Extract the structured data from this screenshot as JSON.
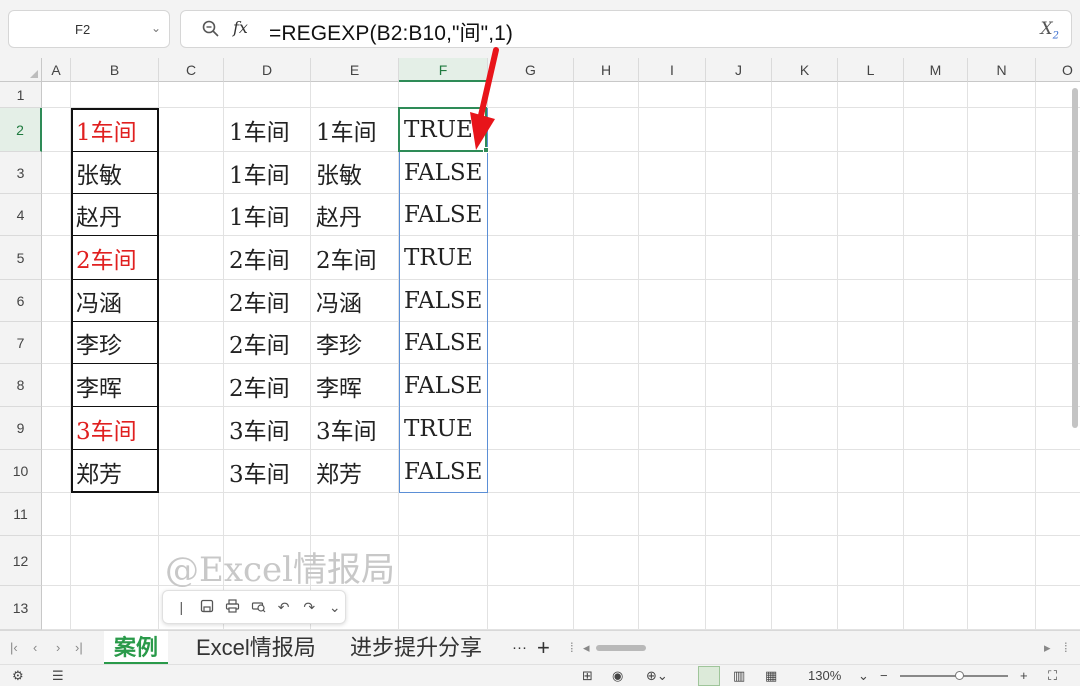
{
  "formula_bar": {
    "cell_ref": "F2",
    "formula": "=REGEXP(B2:B10,\"间\",1)",
    "fx_label": "fx",
    "clear_label": "X"
  },
  "columns": [
    "A",
    "B",
    "C",
    "D",
    "E",
    "F",
    "G",
    "H",
    "I",
    "J",
    "K",
    "L",
    "M",
    "N",
    "O"
  ],
  "rows": [
    "1",
    "2",
    "3",
    "4",
    "5",
    "6",
    "7",
    "8",
    "9",
    "10",
    "11",
    "12",
    "13"
  ],
  "active_column": "F",
  "active_row": "2",
  "cells": {
    "B": [
      "1车间",
      "张敏",
      "赵丹",
      "2车间",
      "冯涵",
      "李珍",
      "李晖",
      "3车间",
      "郑芳"
    ],
    "D": [
      "1车间",
      "1车间",
      "1车间",
      "2车间",
      "2车间",
      "2车间",
      "2车间",
      "3车间",
      "3车间"
    ],
    "E": [
      "1车间",
      "张敏",
      "赵丹",
      "2车间",
      "冯涵",
      "李珍",
      "李晖",
      "3车间",
      "郑芳"
    ],
    "F": [
      "TRUE",
      "FALSE",
      "FALSE",
      "TRUE",
      "FALSE",
      "FALSE",
      "FALSE",
      "TRUE",
      "FALSE"
    ]
  },
  "highlight_color": "#e02020",
  "watermark": "@Excel情报局",
  "sheet_tabs": [
    "案例",
    "Excel情报局",
    "进步提升分享"
  ],
  "active_sheet": "案例",
  "tab_more": "···",
  "tab_add": "+",
  "zoom_level": "130%",
  "accent_color": "#2e8b57",
  "icons": [
    "zoom-function-icon",
    "clear-formula-icon",
    "save-icon",
    "print-icon",
    "print-preview-icon",
    "undo-icon",
    "redo-icon",
    "dropdown-icon"
  ]
}
